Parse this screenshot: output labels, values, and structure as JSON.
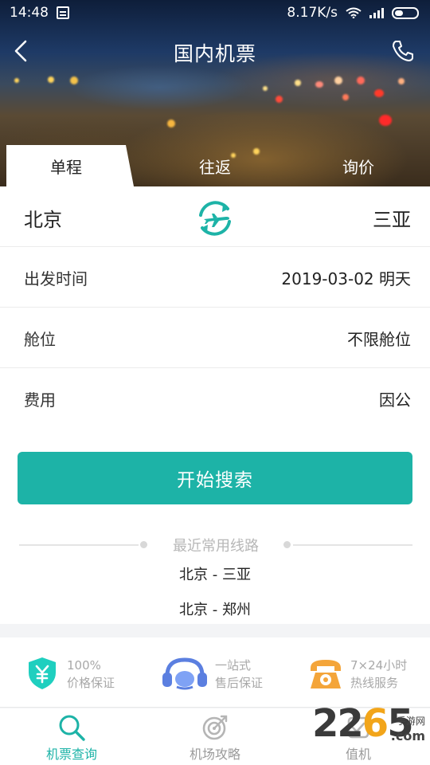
{
  "status_bar": {
    "time": "14:48",
    "speed": "8.17K/s"
  },
  "header": {
    "title": "国内机票"
  },
  "tabs": [
    {
      "label": "单程",
      "active": true
    },
    {
      "label": "往返",
      "active": false
    },
    {
      "label": "询价",
      "active": false
    }
  ],
  "route": {
    "from": "北京",
    "to": "三亚"
  },
  "form": {
    "departure": {
      "label": "出发时间",
      "value": "2019-03-02 明天"
    },
    "cabin": {
      "label": "舱位",
      "value": "不限舱位"
    },
    "fee": {
      "label": "费用",
      "value": "因公"
    }
  },
  "search_button": "开始搜索",
  "recent": {
    "title": "最近常用线路",
    "routes": [
      "北京 - 三亚",
      "北京 - 郑州"
    ]
  },
  "features": [
    {
      "line1": "100%",
      "line2": "价格保证",
      "icon": "shield-yuan-icon"
    },
    {
      "line1": "一站式",
      "line2": "售后保证",
      "icon": "headset-icon"
    },
    {
      "line1": "7×24小时",
      "line2": "热线服务",
      "icon": "telephone-icon"
    }
  ],
  "bottom_nav": [
    {
      "label": "机票查询",
      "icon": "search-icon",
      "active": true
    },
    {
      "label": "机场攻略",
      "icon": "target-icon",
      "active": false
    },
    {
      "label": "值机",
      "icon": "checkin-icon",
      "active": false
    }
  ],
  "watermark": {
    "number_a": "22",
    "number_b": "6",
    "number_c": "5",
    "text": "手游网",
    "domain": ".com"
  },
  "colors": {
    "accent": "#1db3a7",
    "phone_orange": "#f4a53a",
    "headset_blue": "#5b7fe0"
  }
}
